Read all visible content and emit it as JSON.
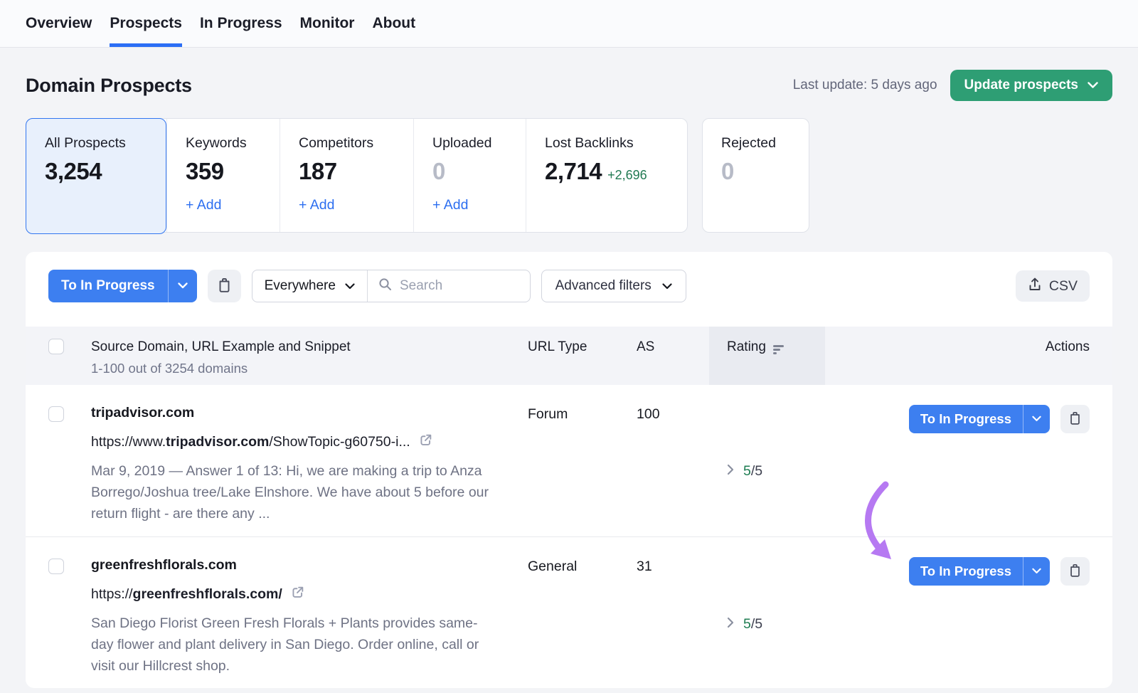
{
  "nav": {
    "tabs": [
      "Overview",
      "Prospects",
      "In Progress",
      "Monitor",
      "About"
    ],
    "active_tab": "Prospects"
  },
  "header": {
    "title": "Domain Prospects",
    "last_update": "Last update: 5 days ago",
    "update_button_label": "Update prospects"
  },
  "stats": {
    "cards": [
      {
        "label": "All Prospects",
        "value": "3,254"
      },
      {
        "label": "Keywords",
        "value": "359",
        "add_label": "+ Add"
      },
      {
        "label": "Competitors",
        "value": "187",
        "add_label": "+ Add"
      },
      {
        "label": "Uploaded",
        "value": "0",
        "add_label": "+ Add"
      },
      {
        "label": "Lost Backlinks",
        "value": "2,714",
        "delta": "+2,696"
      }
    ],
    "rejected": {
      "label": "Rejected",
      "value": "0"
    }
  },
  "toolbar": {
    "bulk_action_label": "To In Progress",
    "scope_value": "Everywhere",
    "search_placeholder": "Search",
    "advanced_filters_label": "Advanced filters",
    "csv_label": "CSV"
  },
  "table": {
    "header": {
      "source": "Source Domain, URL Example and Snippet",
      "range": "1-100 out of 3254 domains",
      "url_type": "URL Type",
      "as": "AS",
      "rating": "Rating",
      "actions": "Actions"
    },
    "rows": [
      {
        "domain": "tripadvisor.com",
        "url_prefix": "https://www.",
        "url_domain": "tripadvisor.com",
        "url_suffix": "/ShowTopic-g60750-i...",
        "snippet": "Mar 9, 2019 — Answer 1 of 13: Hi, we are making a trip to Anza Borrego/Joshua tree/Lake Elnshore. We have about 5 before our return flight - are there any ...",
        "url_type": "Forum",
        "as": "100",
        "rating_value": "5",
        "rating_max": "/5",
        "action_label": "To In Progress"
      },
      {
        "domain": "greenfreshflorals.com",
        "url_prefix": "https://",
        "url_domain": "greenfreshflorals.com/",
        "url_suffix": "",
        "snippet": "San Diego Florist Green Fresh Florals + Plants provides same-day flower and plant delivery in San Diego. Order online, call or visit our Hillcrest shop.",
        "url_type": "General",
        "as": "31",
        "rating_value": "5",
        "rating_max": "/5",
        "action_label": "To In Progress"
      }
    ]
  },
  "colors": {
    "accent_blue": "#3d7ff0",
    "active_tab_blue": "#2b6ef5",
    "green_button": "#2e9e74",
    "green_text": "#217a52",
    "annotation_arrow_purple": "#b679f2",
    "active_card_bg": "#e8f0fc"
  }
}
